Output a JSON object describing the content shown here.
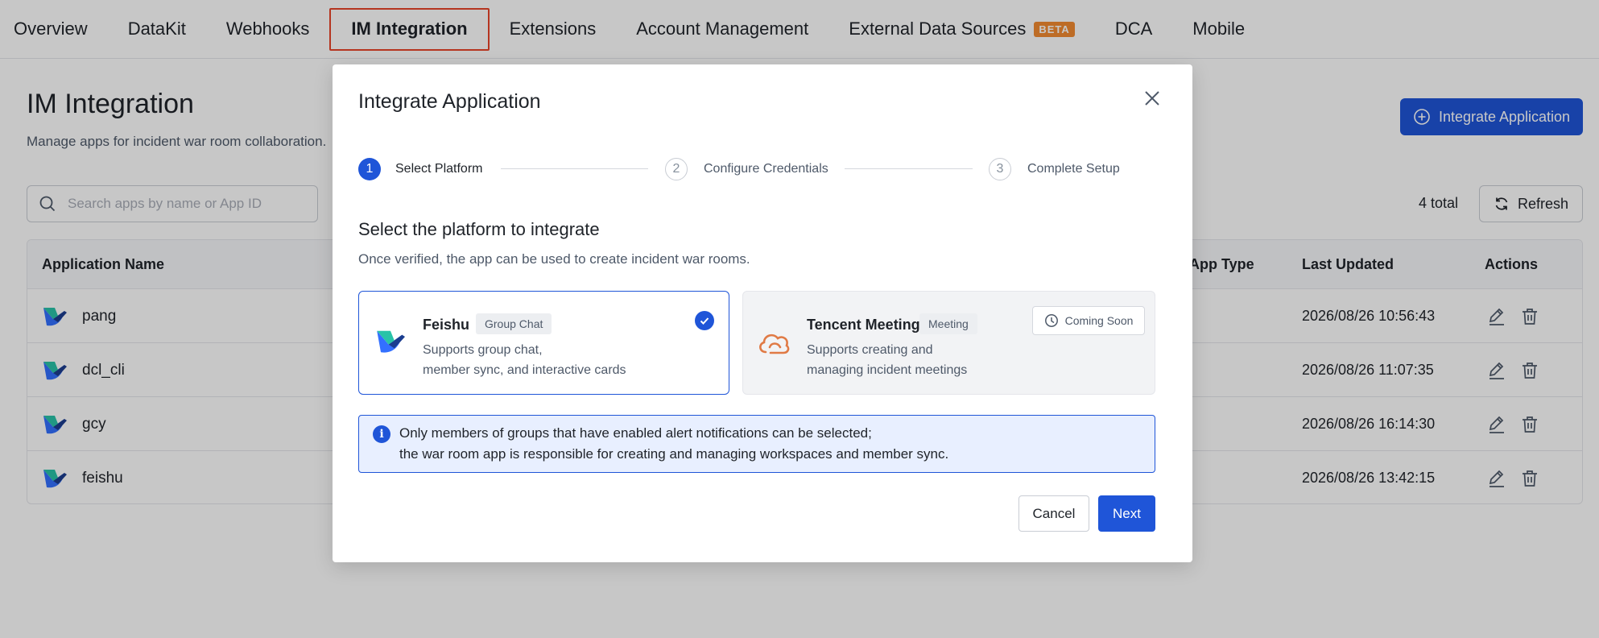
{
  "nav": {
    "items": [
      {
        "label": "Overview"
      },
      {
        "label": "DataKit"
      },
      {
        "label": "Webhooks"
      },
      {
        "label": "IM Integration",
        "active": true
      },
      {
        "label": "Extensions"
      },
      {
        "label": "Account Management"
      },
      {
        "label": "External Data Sources",
        "badge": "BETA"
      },
      {
        "label": "DCA"
      },
      {
        "label": "Mobile"
      }
    ]
  },
  "page": {
    "title": "IM Integration",
    "description": "Manage apps for incident war room collaboration.",
    "integrate_button": "Integrate Application",
    "search_placeholder": "Search apps by name or App ID",
    "total": "4 total",
    "refresh_button": "Refresh"
  },
  "table": {
    "columns": {
      "name": "Application Name",
      "app_type": "App Type",
      "last_updated": "Last Updated",
      "actions": "Actions"
    },
    "rows": [
      {
        "name": "pang",
        "last_updated": "2026/08/26 10:56:43"
      },
      {
        "name": "dcl_cli",
        "last_updated": "2026/08/26 11:07:35"
      },
      {
        "name": "gcy",
        "last_updated": "2026/08/26 16:14:30"
      },
      {
        "name": "feishu",
        "last_updated": "2026/08/26 13:42:15"
      }
    ]
  },
  "modal": {
    "title": "Integrate Application",
    "steps": [
      {
        "number": "1",
        "label": "Select Platform",
        "state": "active"
      },
      {
        "number": "2",
        "label": "Configure Credentials",
        "state": "pending"
      },
      {
        "number": "3",
        "label": "Complete Setup",
        "state": "pending"
      }
    ],
    "section_title": "Select the platform to integrate",
    "section_desc": "Once verified, the app can be used to create incident war rooms.",
    "platforms": [
      {
        "name": "Feishu",
        "tag": "Group Chat",
        "desc_line1": "Supports group chat,",
        "desc_line2": "member sync, and interactive cards",
        "selected": true
      },
      {
        "name": "Tencent Meeting",
        "tag": "Meeting",
        "desc_line1": "Supports creating and",
        "desc_line2": "managing incident meetings",
        "status": "Coming Soon"
      }
    ],
    "info": {
      "icon": "i",
      "line1": "Only members of groups that have enabled alert notifications can be selected;",
      "line2": "the war room app is responsible for creating and managing workspaces and member sync."
    },
    "cancel_button": "Cancel",
    "next_button": "Next"
  },
  "colors": {
    "primary": "#1f55d8",
    "active_tab_border": "#e8442a",
    "beta_badge": "#f28b31",
    "tencent_icon": "#e07a45"
  }
}
